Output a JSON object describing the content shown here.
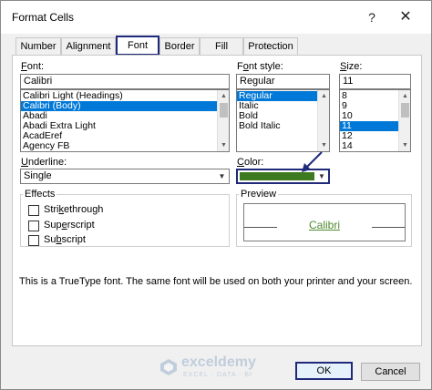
{
  "window": {
    "title": "Format Cells",
    "help": "?",
    "close": "✕"
  },
  "tabs": [
    "Number",
    "Alignment",
    "Font",
    "Border",
    "Fill",
    "Protection"
  ],
  "font": {
    "label_first": "F",
    "label_rest": "ont:",
    "value": "Calibri",
    "items": [
      "Calibri Light (Headings)",
      "Calibri (Body)",
      "Abadi",
      "Abadi Extra Light",
      "AcadEref",
      "Agency FB"
    ],
    "selected_index": 1
  },
  "font_style": {
    "label_pre": "F",
    "label_u": "o",
    "label_post": "nt style:",
    "value": "Regular",
    "items": [
      "Regular",
      "Italic",
      "Bold",
      "Bold Italic"
    ],
    "selected_index": 0
  },
  "size": {
    "label_first": "S",
    "label_rest": "ize:",
    "value": "11",
    "items": [
      "8",
      "9",
      "10",
      "11",
      "12",
      "14"
    ],
    "selected_index": 3
  },
  "underline": {
    "label_first": "U",
    "label_rest": "nderline:",
    "value": "Single"
  },
  "color": {
    "label_first": "C",
    "label_rest": "olor:",
    "swatch": "#3d7a1f"
  },
  "effects": {
    "title": "Effects",
    "items": [
      {
        "pre": "Stri",
        "u": "k",
        "post": "ethrough"
      },
      {
        "pre": "Sup",
        "u": "e",
        "post": "rscript"
      },
      {
        "pre": "Su",
        "u": "b",
        "post": "script"
      }
    ]
  },
  "preview": {
    "title": "Preview",
    "sample": "Calibri",
    "sample_color": "#4e8a2e"
  },
  "note": "This is a TrueType font.  The same font will be used on both your printer and your screen.",
  "buttons": {
    "ok": "OK",
    "cancel": "Cancel"
  },
  "watermark": {
    "name": "exceldemy",
    "sub": "EXCEL · DATA · BI"
  },
  "colors": {
    "accent_border": "#1f2a7a",
    "selection": "#0078d7"
  }
}
